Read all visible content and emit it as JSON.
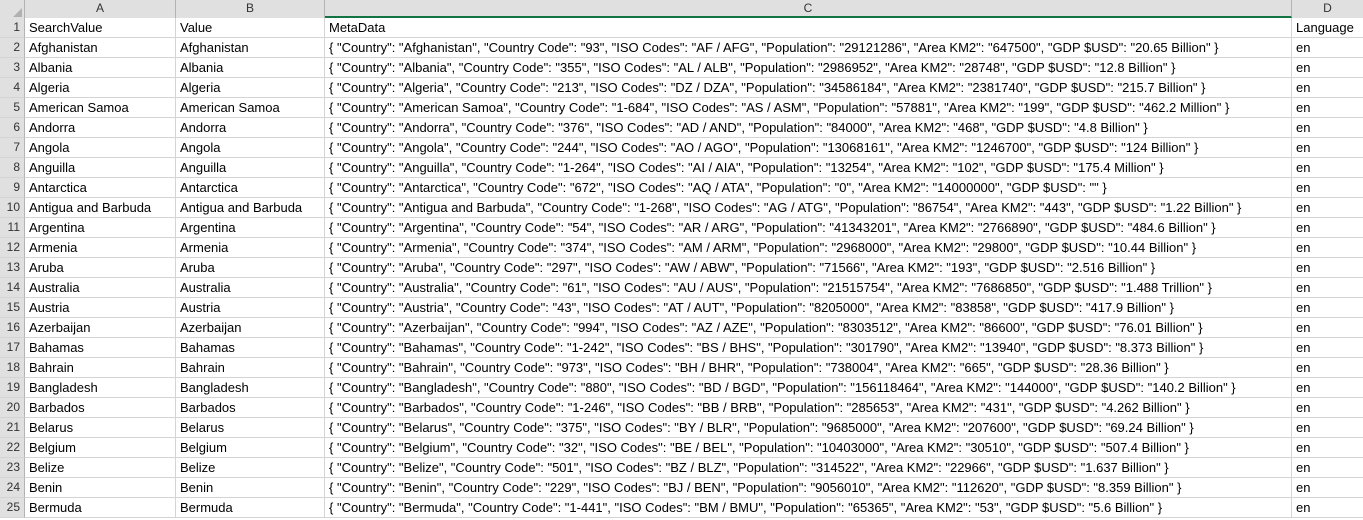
{
  "spreadsheet": {
    "select_all_icon": "select-all-triangle-icon",
    "column_headers": [
      {
        "letter": "A",
        "selected": false
      },
      {
        "letter": "B",
        "selected": false
      },
      {
        "letter": "C",
        "selected": true
      },
      {
        "letter": "D",
        "selected": false
      }
    ],
    "selection_accent_color": "#127443",
    "header_background": "#e0e0e0",
    "gridline_color": "#d4d4d4",
    "rows": [
      {
        "num": "1",
        "a": "SearchValue",
        "b": "Value",
        "c": "MetaData",
        "d": "Language"
      },
      {
        "num": "2",
        "a": "Afghanistan",
        "b": "Afghanistan",
        "c": "{ \"Country\": \"Afghanistan\", \"Country Code\": \"93\", \"ISO Codes\": \"AF / AFG\", \"Population\": \"29121286\", \"Area KM2\": \"647500\", \"GDP $USD\": \"20.65 Billion\" }",
        "d": "en"
      },
      {
        "num": "3",
        "a": "Albania",
        "b": "Albania",
        "c": "{ \"Country\": \"Albania\", \"Country Code\": \"355\", \"ISO Codes\": \"AL / ALB\", \"Population\": \"2986952\", \"Area KM2\": \"28748\", \"GDP $USD\": \"12.8 Billion\" }",
        "d": "en"
      },
      {
        "num": "4",
        "a": "Algeria",
        "b": "Algeria",
        "c": "{ \"Country\": \"Algeria\", \"Country Code\": \"213\", \"ISO Codes\": \"DZ / DZA\", \"Population\": \"34586184\", \"Area KM2\": \"2381740\", \"GDP $USD\": \"215.7 Billion\" }",
        "d": "en"
      },
      {
        "num": "5",
        "a": "American Samoa",
        "b": "American Samoa",
        "c": "{ \"Country\": \"American Samoa\", \"Country Code\": \"1-684\", \"ISO Codes\": \"AS / ASM\", \"Population\": \"57881\", \"Area KM2\": \"199\", \"GDP $USD\": \"462.2 Million\" }",
        "d": "en"
      },
      {
        "num": "6",
        "a": "Andorra",
        "b": "Andorra",
        "c": "{ \"Country\": \"Andorra\", \"Country Code\": \"376\", \"ISO Codes\": \"AD / AND\", \"Population\": \"84000\", \"Area KM2\": \"468\", \"GDP $USD\": \"4.8 Billion\" }",
        "d": "en"
      },
      {
        "num": "7",
        "a": "Angola",
        "b": "Angola",
        "c": "{ \"Country\": \"Angola\", \"Country Code\": \"244\", \"ISO Codes\": \"AO / AGO\", \"Population\": \"13068161\", \"Area KM2\": \"1246700\", \"GDP $USD\": \"124 Billion\" }",
        "d": "en"
      },
      {
        "num": "8",
        "a": "Anguilla",
        "b": "Anguilla",
        "c": "{ \"Country\": \"Anguilla\", \"Country Code\": \"1-264\", \"ISO Codes\": \"AI / AIA\", \"Population\": \"13254\", \"Area KM2\": \"102\", \"GDP $USD\": \"175.4 Million\" }",
        "d": "en"
      },
      {
        "num": "9",
        "a": "Antarctica",
        "b": "Antarctica",
        "c": "{ \"Country\": \"Antarctica\", \"Country Code\": \"672\", \"ISO Codes\": \"AQ / ATA\", \"Population\": \"0\", \"Area KM2\": \"14000000\", \"GDP $USD\": \"\" }",
        "d": "en"
      },
      {
        "num": "10",
        "a": "Antigua and Barbuda",
        "b": "Antigua and Barbuda",
        "c": "{ \"Country\": \"Antigua and Barbuda\", \"Country Code\": \"1-268\", \"ISO Codes\": \"AG / ATG\", \"Population\": \"86754\", \"Area KM2\": \"443\", \"GDP $USD\": \"1.22 Billion\" }",
        "d": "en"
      },
      {
        "num": "11",
        "a": "Argentina",
        "b": "Argentina",
        "c": "{ \"Country\": \"Argentina\", \"Country Code\": \"54\", \"ISO Codes\": \"AR / ARG\", \"Population\": \"41343201\", \"Area KM2\": \"2766890\", \"GDP $USD\": \"484.6 Billion\" }",
        "d": "en"
      },
      {
        "num": "12",
        "a": "Armenia",
        "b": "Armenia",
        "c": "{ \"Country\": \"Armenia\", \"Country Code\": \"374\", \"ISO Codes\": \"AM / ARM\", \"Population\": \"2968000\", \"Area KM2\": \"29800\", \"GDP $USD\": \"10.44 Billion\" }",
        "d": "en"
      },
      {
        "num": "13",
        "a": "Aruba",
        "b": "Aruba",
        "c": "{ \"Country\": \"Aruba\", \"Country Code\": \"297\", \"ISO Codes\": \"AW / ABW\", \"Population\": \"71566\", \"Area KM2\": \"193\", \"GDP $USD\": \"2.516 Billion\" }",
        "d": "en"
      },
      {
        "num": "14",
        "a": "Australia",
        "b": "Australia",
        "c": "{ \"Country\": \"Australia\", \"Country Code\": \"61\", \"ISO Codes\": \"AU / AUS\", \"Population\": \"21515754\", \"Area KM2\": \"7686850\", \"GDP $USD\": \"1.488 Trillion\" }",
        "d": "en"
      },
      {
        "num": "15",
        "a": "Austria",
        "b": "Austria",
        "c": "{ \"Country\": \"Austria\", \"Country Code\": \"43\", \"ISO Codes\": \"AT / AUT\", \"Population\": \"8205000\", \"Area KM2\": \"83858\", \"GDP $USD\": \"417.9 Billion\" }",
        "d": "en"
      },
      {
        "num": "16",
        "a": "Azerbaijan",
        "b": "Azerbaijan",
        "c": "{ \"Country\": \"Azerbaijan\", \"Country Code\": \"994\", \"ISO Codes\": \"AZ / AZE\", \"Population\": \"8303512\", \"Area KM2\": \"86600\", \"GDP $USD\": \"76.01 Billion\" }",
        "d": "en"
      },
      {
        "num": "17",
        "a": "Bahamas",
        "b": "Bahamas",
        "c": "{ \"Country\": \"Bahamas\", \"Country Code\": \"1-242\", \"ISO Codes\": \"BS / BHS\", \"Population\": \"301790\", \"Area KM2\": \"13940\", \"GDP $USD\": \"8.373 Billion\" }",
        "d": "en"
      },
      {
        "num": "18",
        "a": "Bahrain",
        "b": "Bahrain",
        "c": "{ \"Country\": \"Bahrain\", \"Country Code\": \"973\", \"ISO Codes\": \"BH / BHR\", \"Population\": \"738004\", \"Area KM2\": \"665\", \"GDP $USD\": \"28.36 Billion\" }",
        "d": "en"
      },
      {
        "num": "19",
        "a": "Bangladesh",
        "b": "Bangladesh",
        "c": "{ \"Country\": \"Bangladesh\", \"Country Code\": \"880\", \"ISO Codes\": \"BD / BGD\", \"Population\": \"156118464\", \"Area KM2\": \"144000\", \"GDP $USD\": \"140.2 Billion\" }",
        "d": "en"
      },
      {
        "num": "20",
        "a": "Barbados",
        "b": "Barbados",
        "c": "{ \"Country\": \"Barbados\", \"Country Code\": \"1-246\", \"ISO Codes\": \"BB / BRB\", \"Population\": \"285653\", \"Area KM2\": \"431\", \"GDP $USD\": \"4.262 Billion\" }",
        "d": "en"
      },
      {
        "num": "21",
        "a": "Belarus",
        "b": "Belarus",
        "c": "{ \"Country\": \"Belarus\", \"Country Code\": \"375\", \"ISO Codes\": \"BY / BLR\", \"Population\": \"9685000\", \"Area KM2\": \"207600\", \"GDP $USD\": \"69.24 Billion\" }",
        "d": "en"
      },
      {
        "num": "22",
        "a": "Belgium",
        "b": "Belgium",
        "c": "{ \"Country\": \"Belgium\", \"Country Code\": \"32\", \"ISO Codes\": \"BE / BEL\", \"Population\": \"10403000\", \"Area KM2\": \"30510\", \"GDP $USD\": \"507.4 Billion\" }",
        "d": "en"
      },
      {
        "num": "23",
        "a": "Belize",
        "b": "Belize",
        "c": "{ \"Country\": \"Belize\", \"Country Code\": \"501\", \"ISO Codes\": \"BZ / BLZ\", \"Population\": \"314522\", \"Area KM2\": \"22966\", \"GDP $USD\": \"1.637 Billion\" }",
        "d": "en"
      },
      {
        "num": "24",
        "a": "Benin",
        "b": "Benin",
        "c": "{ \"Country\": \"Benin\", \"Country Code\": \"229\", \"ISO Codes\": \"BJ / BEN\", \"Population\": \"9056010\", \"Area KM2\": \"112620\", \"GDP $USD\": \"8.359 Billion\" }",
        "d": "en"
      },
      {
        "num": "25",
        "a": "Bermuda",
        "b": "Bermuda",
        "c": "{ \"Country\": \"Bermuda\", \"Country Code\": \"1-441\", \"ISO Codes\": \"BM / BMU\", \"Population\": \"65365\", \"Area KM2\": \"53\", \"GDP $USD\": \"5.6 Billion\" }",
        "d": "en"
      }
    ]
  }
}
